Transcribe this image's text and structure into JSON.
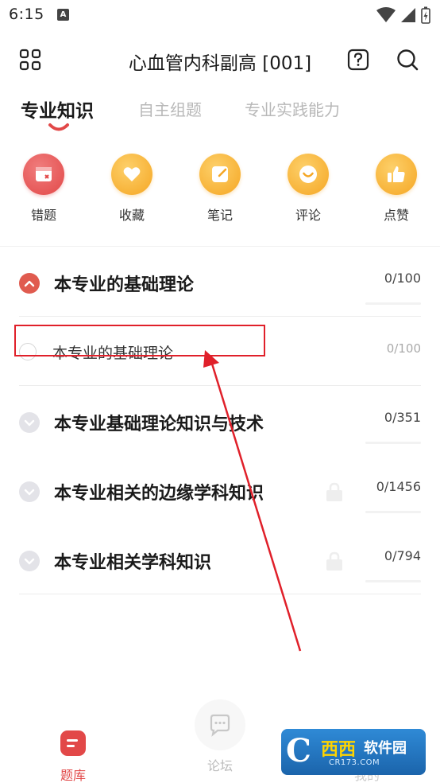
{
  "status_bar": {
    "time": "6:15",
    "notif_glyph": "A"
  },
  "header": {
    "title": "心血管内科副高 [001]"
  },
  "tabs": [
    {
      "label": "专业知识",
      "active": true
    },
    {
      "label": "自主组题",
      "active": false
    },
    {
      "label": "专业实践能力",
      "active": false
    }
  ],
  "quick_actions": [
    {
      "label": "错题",
      "icon": "wrong-question-icon",
      "color": "#e24848"
    },
    {
      "label": "收藏",
      "icon": "heart-icon",
      "color": "#f5a623"
    },
    {
      "label": "笔记",
      "icon": "note-icon",
      "color": "#f5a623"
    },
    {
      "label": "评论",
      "icon": "comment-icon",
      "color": "#f5a623"
    },
    {
      "label": "点赞",
      "icon": "thumbs-up-icon",
      "color": "#f5a623"
    }
  ],
  "sections": [
    {
      "title": "本专业的基础理论",
      "count": "0/100",
      "expanded": true,
      "locked": false
    },
    {
      "title": "本专业基础理论知识与技术",
      "count": "0/351",
      "expanded": false,
      "locked": false
    },
    {
      "title": "本专业相关的边缘学科知识",
      "count": "0/1456",
      "expanded": false,
      "locked": true
    },
    {
      "title": "本专业相关学科知识",
      "count": "0/794",
      "expanded": false,
      "locked": true
    }
  ],
  "sub_item": {
    "title": "本专业的基础理论",
    "count": "0/100"
  },
  "bottom_nav": [
    {
      "label": "题库",
      "active": true
    },
    {
      "label": "论坛",
      "active": false
    },
    {
      "label": "我的",
      "active": false
    }
  ],
  "watermark": {
    "c": "C",
    "cn": "西西",
    "soft": "软件园",
    "url": "CR173.COM"
  },
  "colors": {
    "accent": "#e24848",
    "yellow": "#f5a623",
    "annotation": "#e0202a"
  }
}
